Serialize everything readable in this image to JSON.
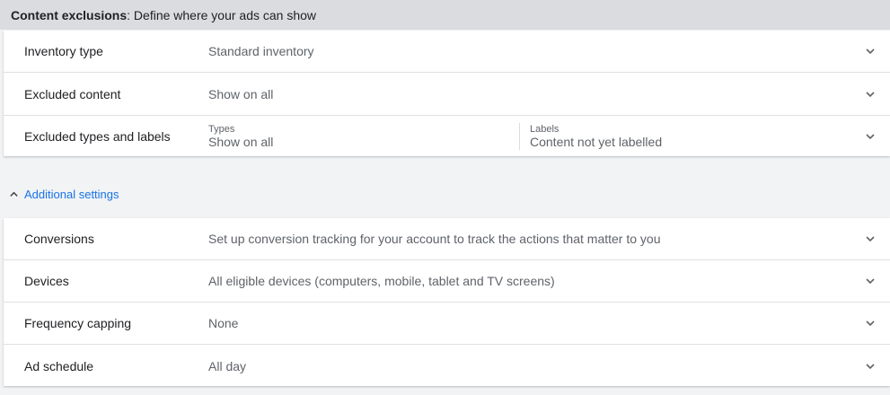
{
  "header": {
    "title_bold": "Content exclusions",
    "title_rest": ": Define where your ads can show"
  },
  "content_exclusions": {
    "rows": [
      {
        "label": "Inventory type",
        "value": "Standard inventory"
      },
      {
        "label": "Excluded content",
        "value": "Show on all"
      }
    ],
    "types_labels": {
      "label": "Excluded types and labels",
      "types_caption": "Types",
      "types_value": "Show on all",
      "labels_caption": "Labels",
      "labels_value": "Content not yet labelled"
    }
  },
  "additional_settings": {
    "toggle_label": "Additional settings",
    "rows": [
      {
        "label": "Conversions",
        "value": "Set up conversion tracking for your account to track the actions that matter to you"
      },
      {
        "label": "Devices",
        "value": "All eligible devices (computers, mobile, tablet and TV screens)"
      },
      {
        "label": "Frequency capping",
        "value": "None"
      },
      {
        "label": "Ad schedule",
        "value": "All day"
      }
    ]
  },
  "icons": {
    "row_expand": "chevron-down-icon",
    "section_collapse": "chevron-up-icon"
  },
  "colors": {
    "link": "#1a73e8",
    "header_bg": "#dadce0",
    "page_bg": "#f1f3f4"
  }
}
